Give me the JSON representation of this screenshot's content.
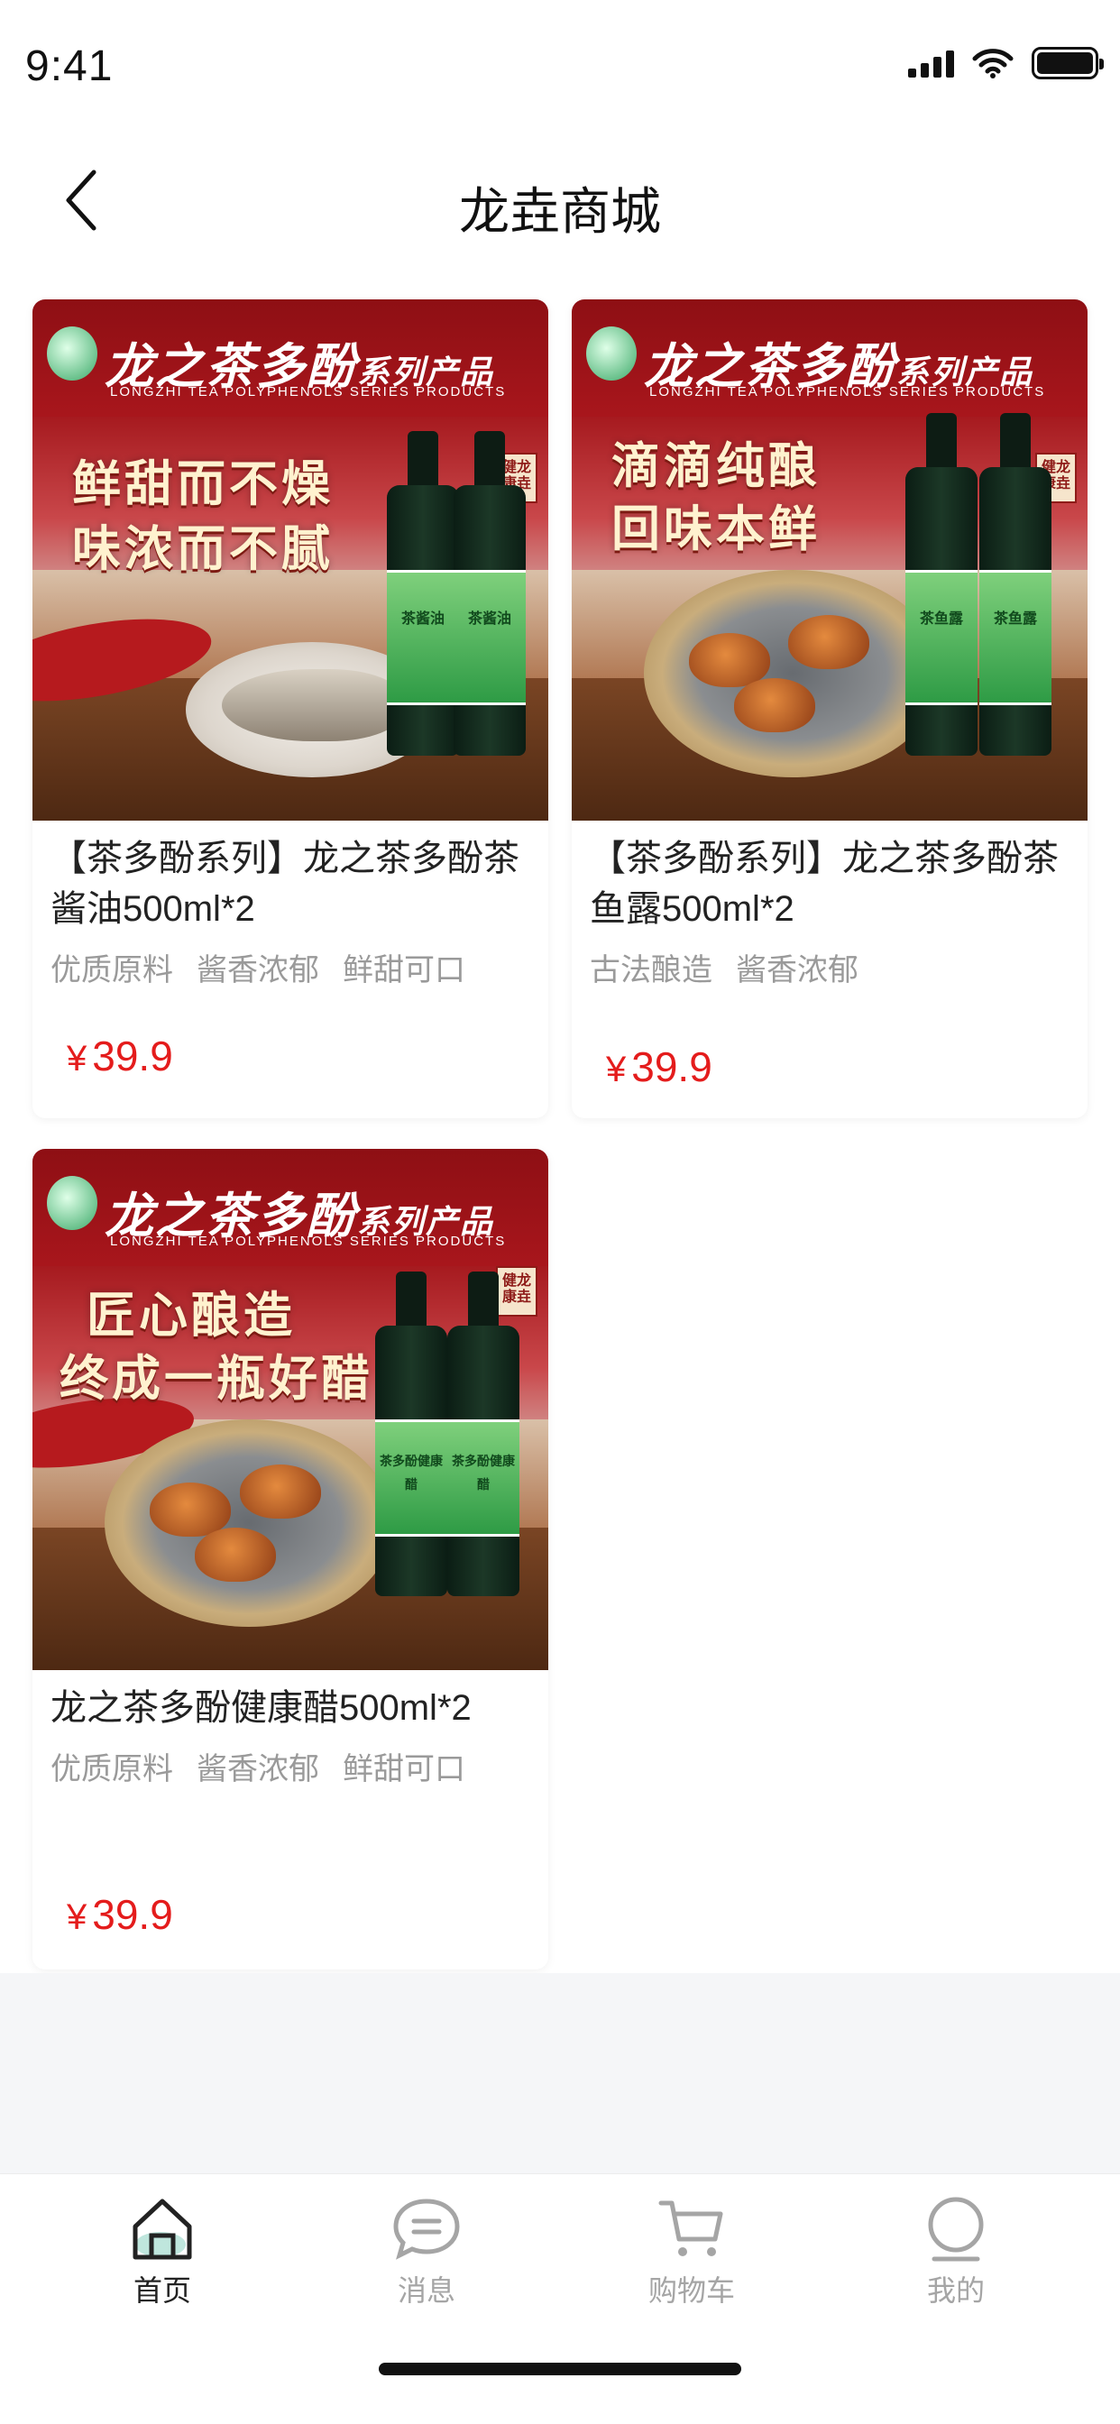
{
  "status_bar": {
    "time": "9:41"
  },
  "nav": {
    "title": "龙垚商城"
  },
  "products": [
    {
      "brand": "龙之茶多酚",
      "brand_suffix": "系列产品",
      "brand_sub": "LONGZHI TEA POLYPHENOLS SERIES PRODUCTS",
      "slogan_1": "鲜甜而不燥",
      "slogan_2": "味浓而不腻",
      "bottle_text": "茶酱油",
      "title": "【茶多酚系列】龙之茶多酚茶酱油500ml*2",
      "tags": [
        "优质原料",
        "酱香浓郁",
        "鲜甜可口"
      ],
      "currency": "¥",
      "price": "39.9"
    },
    {
      "brand": "龙之茶多酚",
      "brand_suffix": "系列产品",
      "brand_sub": "LONGZHI TEA POLYPHENOLS SERIES PRODUCTS",
      "slogan_1": "滴滴纯酿",
      "slogan_2": "回味本鲜",
      "bottle_text": "茶鱼露",
      "title": "【茶多酚系列】龙之茶多酚茶鱼露500ml*2",
      "tags": [
        "古法酿造",
        "酱香浓郁"
      ],
      "currency": "¥",
      "price": "39.9"
    },
    {
      "brand": "龙之茶多酚",
      "brand_suffix": "系列产品",
      "brand_sub": "LONGZHI TEA POLYPHENOLS SERIES PRODUCTS",
      "slogan_1": "匠心酿造",
      "slogan_2": "终成一瓶好醋",
      "bottle_text": "茶多酚健康醋",
      "title": "龙之茶多酚健康醋500ml*2",
      "tags": [
        "优质原料",
        "酱香浓郁",
        "鲜甜可口"
      ],
      "currency": "¥",
      "price": "39.9"
    }
  ],
  "tabbar": {
    "tabs": [
      {
        "label": "首页",
        "icon": "home-icon",
        "active": true
      },
      {
        "label": "消息",
        "icon": "message-icon",
        "active": false
      },
      {
        "label": "购物车",
        "icon": "cart-icon",
        "active": false
      },
      {
        "label": "我的",
        "icon": "profile-icon",
        "active": false
      }
    ]
  },
  "colors": {
    "price": "#e41c1c",
    "tag": "#9a9a9a",
    "active_tab": "#222222",
    "inactive_tab": "#a5a5a5"
  }
}
